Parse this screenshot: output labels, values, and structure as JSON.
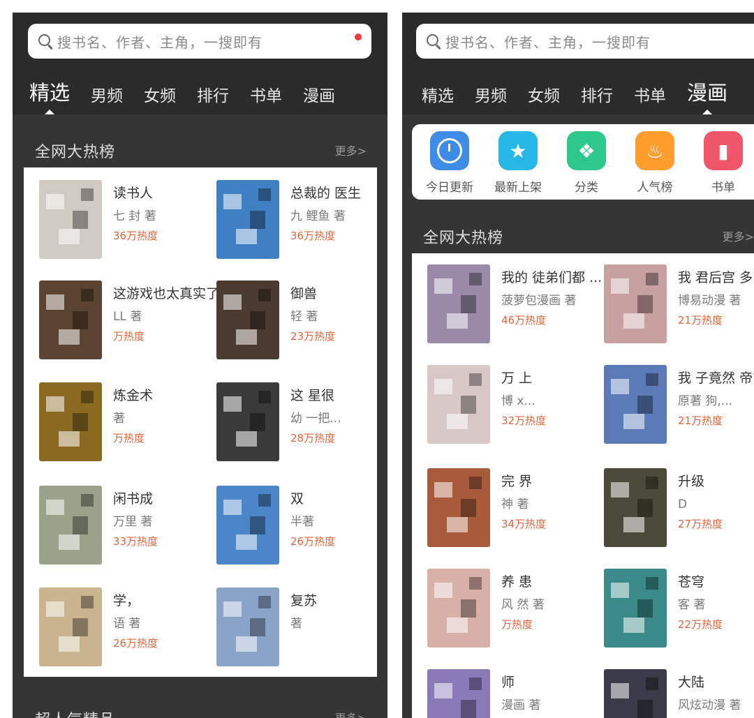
{
  "left": {
    "search_placeholder": "搜书名、作者、主角，一搜即有",
    "tabs": [
      "精选",
      "男频",
      "女频",
      "排行",
      "书单",
      "漫画"
    ],
    "active_tab": "精选",
    "section": {
      "title": "全网大热榜",
      "more": "更多>"
    },
    "next_section": {
      "title": "超人气精品",
      "more": "更多>"
    },
    "books": [
      {
        "title": "读书人",
        "author": "七 封 著",
        "heat": "36万热度",
        "cover": "#cfcac2"
      },
      {
        "title": "总裁的 医生",
        "author": "九 鲤鱼 著",
        "heat": "36万热度",
        "cover": "#3f7fc4"
      },
      {
        "title": "这游戏也太真实了",
        "author": "LL 著",
        "heat": "万热度",
        "cover": "#5a4330"
      },
      {
        "title": "御兽",
        "author": "轻 著",
        "heat": "23万热度",
        "cover": "#4a3a30"
      },
      {
        "title": "炼金术",
        "author": "著",
        "heat": "万热度",
        "cover": "#8a6a20"
      },
      {
        "title": "这 星很",
        "author": "幼 一把...",
        "heat": "28万热度",
        "cover": "#3a3a3a"
      },
      {
        "title": "闲书成",
        "author": "万里 著",
        "heat": "33万热度",
        "cover": "#9aa38a"
      },
      {
        "title": "双",
        "author": "半著",
        "heat": "26万热度",
        "cover": "#4a86c8"
      },
      {
        "title": "学，",
        "author": "语 著",
        "heat": "26万热度",
        "cover": "#c9b48f"
      },
      {
        "title": "复苏",
        "author": "著",
        "heat": "",
        "cover": "#8aa4c8"
      }
    ]
  },
  "right": {
    "search_placeholder": "搜书名、作者、主角，一搜即有",
    "tabs": [
      "精选",
      "男频",
      "女频",
      "排行",
      "书单",
      "漫画"
    ],
    "active_tab": "漫画",
    "quick": [
      {
        "label": "今日更新",
        "icon": "clock-icon",
        "color": "#3e8be8"
      },
      {
        "label": "最新上架",
        "icon": "star-calendar-icon",
        "color": "#28b8e8"
      },
      {
        "label": "分类",
        "icon": "category-grid-icon",
        "color": "#2ec98a"
      },
      {
        "label": "人气榜",
        "icon": "flame-icon",
        "color": "#ff9e2c"
      },
      {
        "label": "书单",
        "icon": "bookmark-book-icon",
        "color": "#f0566a"
      }
    ],
    "section": {
      "title": "全网大热榜",
      "more": "更多>"
    },
    "books": [
      {
        "title": "我的 徒弟们都 ...",
        "author": "菠萝包漫画 著",
        "heat": "46万热度",
        "cover": "#9a8aa8"
      },
      {
        "title": "我 君后宫 多",
        "author": "博易动漫 著",
        "heat": "21万热度",
        "cover": "#c7a0a0"
      },
      {
        "title": "万 上",
        "author": "博 x...",
        "heat": "32万热度",
        "cover": "#d8c8c8"
      },
      {
        "title": "我 子竟然 帝?",
        "author": "原著 狗,...",
        "heat": "21万热度",
        "cover": "#5a7ab8"
      },
      {
        "title": "完 界",
        "author": "神 著",
        "heat": "34万热度",
        "cover": "#a85a3a"
      },
      {
        "title": "升级",
        "author": "D",
        "heat": "27万热度",
        "cover": "#4a4a3a"
      },
      {
        "title": "养 患",
        "author": "风 然 著",
        "heat": "万热度",
        "cover": "#d8b0a8"
      },
      {
        "title": "苍穹",
        "author": "客 著",
        "heat": "22万热度",
        "cover": "#3a8a8a"
      },
      {
        "title": "师",
        "author": "漫画 著",
        "heat": "",
        "cover": "#8a7ab8"
      },
      {
        "title": "大陆",
        "author": "风炫动漫 著",
        "heat": "",
        "cover": "#3a3a48"
      }
    ]
  }
}
